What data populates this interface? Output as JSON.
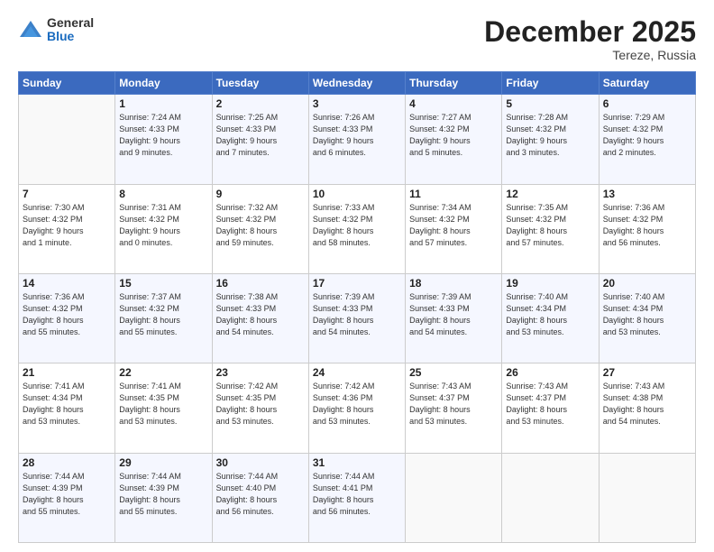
{
  "logo": {
    "general": "General",
    "blue": "Blue"
  },
  "title": "December 2025",
  "location": "Tereze, Russia",
  "days_header": [
    "Sunday",
    "Monday",
    "Tuesday",
    "Wednesday",
    "Thursday",
    "Friday",
    "Saturday"
  ],
  "weeks": [
    [
      {
        "num": "",
        "info": ""
      },
      {
        "num": "1",
        "info": "Sunrise: 7:24 AM\nSunset: 4:33 PM\nDaylight: 9 hours\nand 9 minutes."
      },
      {
        "num": "2",
        "info": "Sunrise: 7:25 AM\nSunset: 4:33 PM\nDaylight: 9 hours\nand 7 minutes."
      },
      {
        "num": "3",
        "info": "Sunrise: 7:26 AM\nSunset: 4:33 PM\nDaylight: 9 hours\nand 6 minutes."
      },
      {
        "num": "4",
        "info": "Sunrise: 7:27 AM\nSunset: 4:32 PM\nDaylight: 9 hours\nand 5 minutes."
      },
      {
        "num": "5",
        "info": "Sunrise: 7:28 AM\nSunset: 4:32 PM\nDaylight: 9 hours\nand 3 minutes."
      },
      {
        "num": "6",
        "info": "Sunrise: 7:29 AM\nSunset: 4:32 PM\nDaylight: 9 hours\nand 2 minutes."
      }
    ],
    [
      {
        "num": "7",
        "info": "Sunrise: 7:30 AM\nSunset: 4:32 PM\nDaylight: 9 hours\nand 1 minute."
      },
      {
        "num": "8",
        "info": "Sunrise: 7:31 AM\nSunset: 4:32 PM\nDaylight: 9 hours\nand 0 minutes."
      },
      {
        "num": "9",
        "info": "Sunrise: 7:32 AM\nSunset: 4:32 PM\nDaylight: 8 hours\nand 59 minutes."
      },
      {
        "num": "10",
        "info": "Sunrise: 7:33 AM\nSunset: 4:32 PM\nDaylight: 8 hours\nand 58 minutes."
      },
      {
        "num": "11",
        "info": "Sunrise: 7:34 AM\nSunset: 4:32 PM\nDaylight: 8 hours\nand 57 minutes."
      },
      {
        "num": "12",
        "info": "Sunrise: 7:35 AM\nSunset: 4:32 PM\nDaylight: 8 hours\nand 57 minutes."
      },
      {
        "num": "13",
        "info": "Sunrise: 7:36 AM\nSunset: 4:32 PM\nDaylight: 8 hours\nand 56 minutes."
      }
    ],
    [
      {
        "num": "14",
        "info": "Sunrise: 7:36 AM\nSunset: 4:32 PM\nDaylight: 8 hours\nand 55 minutes."
      },
      {
        "num": "15",
        "info": "Sunrise: 7:37 AM\nSunset: 4:32 PM\nDaylight: 8 hours\nand 55 minutes."
      },
      {
        "num": "16",
        "info": "Sunrise: 7:38 AM\nSunset: 4:33 PM\nDaylight: 8 hours\nand 54 minutes."
      },
      {
        "num": "17",
        "info": "Sunrise: 7:39 AM\nSunset: 4:33 PM\nDaylight: 8 hours\nand 54 minutes."
      },
      {
        "num": "18",
        "info": "Sunrise: 7:39 AM\nSunset: 4:33 PM\nDaylight: 8 hours\nand 54 minutes."
      },
      {
        "num": "19",
        "info": "Sunrise: 7:40 AM\nSunset: 4:34 PM\nDaylight: 8 hours\nand 53 minutes."
      },
      {
        "num": "20",
        "info": "Sunrise: 7:40 AM\nSunset: 4:34 PM\nDaylight: 8 hours\nand 53 minutes."
      }
    ],
    [
      {
        "num": "21",
        "info": "Sunrise: 7:41 AM\nSunset: 4:34 PM\nDaylight: 8 hours\nand 53 minutes."
      },
      {
        "num": "22",
        "info": "Sunrise: 7:41 AM\nSunset: 4:35 PM\nDaylight: 8 hours\nand 53 minutes."
      },
      {
        "num": "23",
        "info": "Sunrise: 7:42 AM\nSunset: 4:35 PM\nDaylight: 8 hours\nand 53 minutes."
      },
      {
        "num": "24",
        "info": "Sunrise: 7:42 AM\nSunset: 4:36 PM\nDaylight: 8 hours\nand 53 minutes."
      },
      {
        "num": "25",
        "info": "Sunrise: 7:43 AM\nSunset: 4:37 PM\nDaylight: 8 hours\nand 53 minutes."
      },
      {
        "num": "26",
        "info": "Sunrise: 7:43 AM\nSunset: 4:37 PM\nDaylight: 8 hours\nand 53 minutes."
      },
      {
        "num": "27",
        "info": "Sunrise: 7:43 AM\nSunset: 4:38 PM\nDaylight: 8 hours\nand 54 minutes."
      }
    ],
    [
      {
        "num": "28",
        "info": "Sunrise: 7:44 AM\nSunset: 4:39 PM\nDaylight: 8 hours\nand 55 minutes."
      },
      {
        "num": "29",
        "info": "Sunrise: 7:44 AM\nSunset: 4:39 PM\nDaylight: 8 hours\nand 55 minutes."
      },
      {
        "num": "30",
        "info": "Sunrise: 7:44 AM\nSunset: 4:40 PM\nDaylight: 8 hours\nand 56 minutes."
      },
      {
        "num": "31",
        "info": "Sunrise: 7:44 AM\nSunset: 4:41 PM\nDaylight: 8 hours\nand 56 minutes."
      },
      {
        "num": "",
        "info": ""
      },
      {
        "num": "",
        "info": ""
      },
      {
        "num": "",
        "info": ""
      }
    ]
  ]
}
